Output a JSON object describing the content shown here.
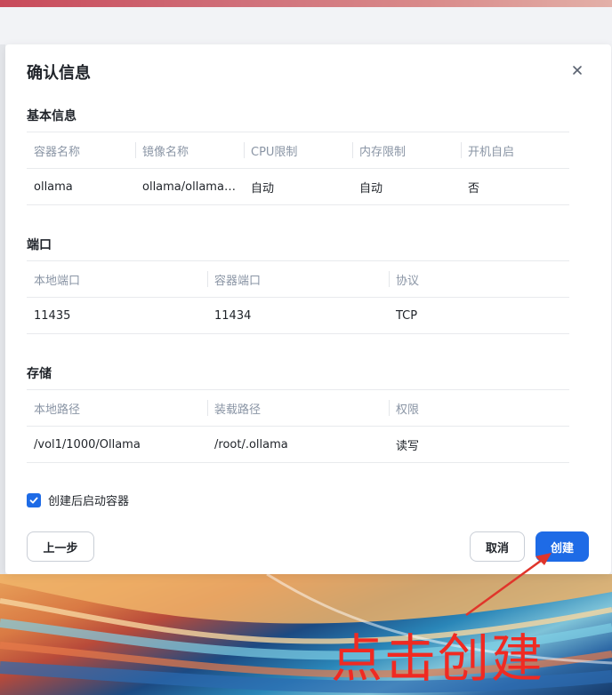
{
  "dialog": {
    "title": "确认信息",
    "close_icon": "close-icon"
  },
  "basic_info": {
    "title": "基本信息",
    "headers": [
      "容器名称",
      "镜像名称",
      "CPU限制",
      "内存限制",
      "开机自启"
    ],
    "row": [
      "ollama",
      "ollama/ollama:l...",
      "自动",
      "自动",
      "否"
    ]
  },
  "ports": {
    "title": "端口",
    "headers": [
      "本地端口",
      "容器端口",
      "协议"
    ],
    "row": [
      "11435",
      "11434",
      "TCP"
    ]
  },
  "storage": {
    "title": "存储",
    "headers": [
      "本地路径",
      "装载路径",
      "权限"
    ],
    "row": [
      "/vol1/1000/Ollama",
      "/root/.ollama",
      "读写"
    ]
  },
  "options": {
    "start_after_create_label": "创建后启动容器",
    "start_after_create_checked": true
  },
  "buttons": {
    "prev": "上一步",
    "cancel": "取消",
    "create": "创建"
  },
  "annotation": {
    "text": "点击创建",
    "color": "#f02a22"
  },
  "colors": {
    "accent": "#1e6be6"
  }
}
